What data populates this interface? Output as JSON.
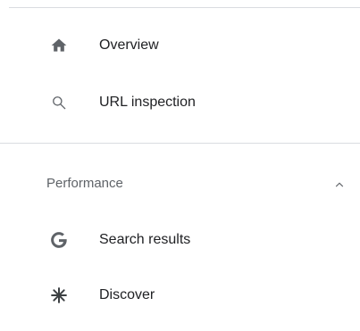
{
  "nav": {
    "items": [
      {
        "label": "Overview",
        "icon": "home-icon"
      },
      {
        "label": "URL inspection",
        "icon": "search-icon"
      }
    ],
    "sections": [
      {
        "label": "Performance",
        "expanded": true,
        "toggle_icon": "chevron-up-icon",
        "items": [
          {
            "label": "Search results",
            "icon": "google-g-icon"
          },
          {
            "label": "Discover",
            "icon": "asterisk-icon"
          }
        ]
      }
    ]
  },
  "colors": {
    "text": "#202124",
    "secondary_text": "#5f6368",
    "icon": "#5f6368",
    "divider": "#dadce0"
  }
}
